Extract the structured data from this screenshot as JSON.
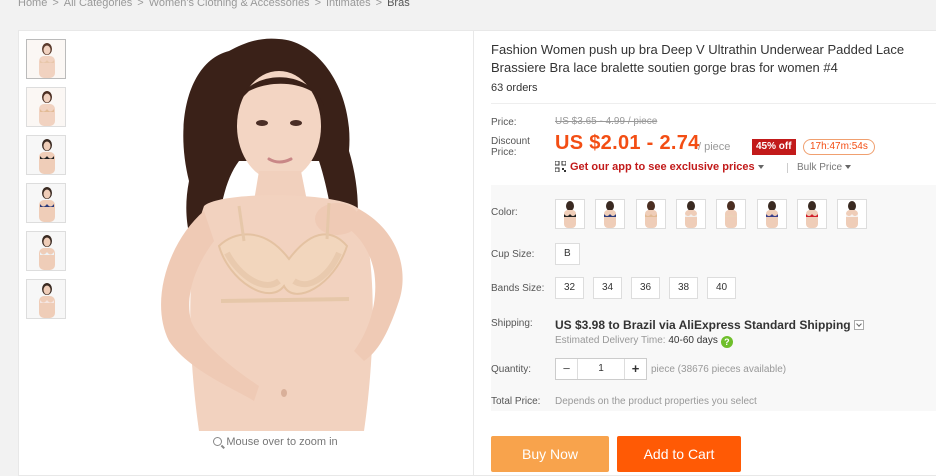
{
  "breadcrumb": {
    "items": [
      "Home",
      "All Categories",
      "Women's Clothing & Accessories",
      "Intimates",
      "Bras"
    ],
    "separator": ">"
  },
  "gallery": {
    "zoom_hint": "Mouse over to zoom in",
    "thumbnails": [
      "nude",
      "nude",
      "black",
      "navy",
      "white",
      "white"
    ]
  },
  "product": {
    "title": "Fashion Women push up bra Deep V Ultrathin Underwear Padded Lace Brassiere Bra lace bralette soutien gorge bras for women #4",
    "orders": "63 orders",
    "price_label": "Price:",
    "original_price": "US $3.65 - 4.99 / piece",
    "discount_label": "Discount Price:",
    "discount_price": "US $2.01 - 2.74",
    "per_unit": "/ piece",
    "discount_badge": "45% off",
    "countdown": "17h:47m:54s",
    "app_promo": "Get our app to see exclusive prices",
    "bulk_price": "Bulk Price",
    "accent_color": "#f34e14",
    "badge_color": "#c21a1a"
  },
  "options": {
    "color_label": "Color:",
    "colors": [
      "black",
      "navy",
      "nude",
      "white-lace",
      "nude-lace",
      "navy-lace",
      "red",
      "white"
    ],
    "cup_label": "Cup Size:",
    "cup_sizes": [
      "B"
    ],
    "band_label": "Bands Size:",
    "band_sizes": [
      "32",
      "34",
      "36",
      "38",
      "40"
    ]
  },
  "shipping": {
    "label": "Shipping:",
    "summary": "US $3.98 to Brazil via AliExpress Standard Shipping",
    "delivery_label": "Estimated Delivery Time:",
    "delivery_value": "40-60 days",
    "help_icon": "?"
  },
  "quantity": {
    "label": "Quantity:",
    "value": "1",
    "minus": "−",
    "plus": "+",
    "available": "piece (38676 pieces available)"
  },
  "total": {
    "label": "Total Price:",
    "value": "Depends on the product properties you select"
  },
  "actions": {
    "buy_now": "Buy Now",
    "add_to_cart": "Add to Cart"
  }
}
